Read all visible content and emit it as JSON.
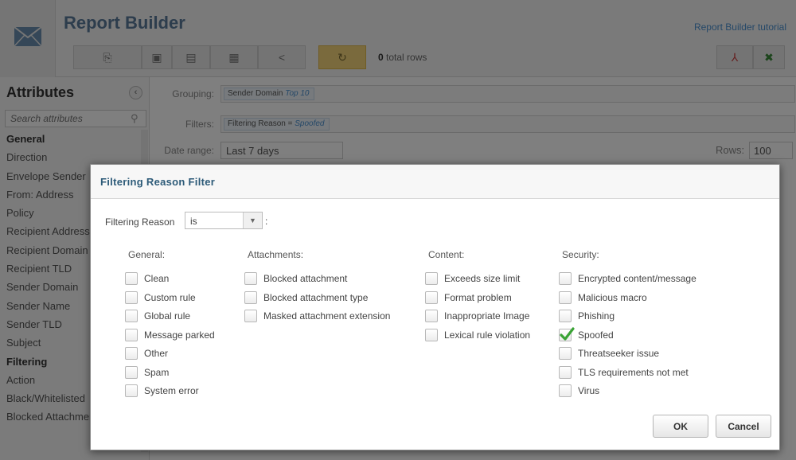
{
  "app": {
    "title": "Report Builder",
    "tutorial_link": "Report Builder tutorial",
    "row_count": "0",
    "row_count_suffix": "total rows"
  },
  "sidebar": {
    "title": "Attributes",
    "search_placeholder": "Search attributes",
    "items": [
      {
        "label": "General",
        "header": true
      },
      {
        "label": "Direction"
      },
      {
        "label": "Envelope Sender"
      },
      {
        "label": "From: Address"
      },
      {
        "label": "Policy"
      },
      {
        "label": "Recipient Address"
      },
      {
        "label": "Recipient Domain"
      },
      {
        "label": "Recipient TLD"
      },
      {
        "label": "Sender Domain"
      },
      {
        "label": "Sender Name"
      },
      {
        "label": "Sender TLD"
      },
      {
        "label": "Subject"
      },
      {
        "label": "Filtering",
        "header": true
      },
      {
        "label": "Action"
      },
      {
        "label": "Black/Whitelisted"
      },
      {
        "label": "Blocked Attachment"
      }
    ]
  },
  "main": {
    "grouping_label": "Grouping:",
    "grouping_chip": "Sender Domain",
    "grouping_chip_extra": "Top 10",
    "filters_label": "Filters:",
    "filter_chip": "Filtering Reason =",
    "filter_chip_value": "Spoofed",
    "date_range_label": "Date range:",
    "date_range_value": "Last 7 days",
    "rows_label": "Rows:",
    "rows_value": "100"
  },
  "dialog": {
    "title": "Filtering Reason Filter",
    "operator_label": "Filtering Reason",
    "operator_value": "is",
    "operator_suffix": ":",
    "groups": [
      {
        "header": "General:",
        "items": [
          {
            "label": "Clean",
            "checked": false
          },
          {
            "label": "Custom rule",
            "checked": false
          },
          {
            "label": "Global rule",
            "checked": false
          },
          {
            "label": "Message parked",
            "checked": false
          },
          {
            "label": "Other",
            "checked": false
          },
          {
            "label": "Spam",
            "checked": false
          },
          {
            "label": "System error",
            "checked": false
          }
        ]
      },
      {
        "header": "Attachments:",
        "items": [
          {
            "label": "Blocked attachment",
            "checked": false
          },
          {
            "label": "Blocked attachment type",
            "checked": false
          },
          {
            "label": "Masked attachment extension",
            "checked": false
          }
        ]
      },
      {
        "header": "Content:",
        "items": [
          {
            "label": "Exceeds size limit",
            "checked": false
          },
          {
            "label": "Format problem",
            "checked": false
          },
          {
            "label": "Inappropriate Image",
            "checked": false
          },
          {
            "label": "Lexical rule violation",
            "checked": false
          }
        ]
      },
      {
        "header": "Security:",
        "items": [
          {
            "label": "Encrypted content/message",
            "checked": false
          },
          {
            "label": "Malicious macro",
            "checked": false
          },
          {
            "label": "Phishing",
            "checked": false
          },
          {
            "label": "Spoofed",
            "checked": true
          },
          {
            "label": "Threatseeker issue",
            "checked": false
          },
          {
            "label": "TLS requirements not met",
            "checked": false
          },
          {
            "label": "Virus",
            "checked": false
          }
        ]
      }
    ],
    "ok_label": "OK",
    "cancel_label": "Cancel"
  },
  "colors": {
    "accent": "#2c5a78",
    "link": "#4a90d0",
    "check": "#3aa335",
    "refresh_button": "#f5d57a"
  }
}
